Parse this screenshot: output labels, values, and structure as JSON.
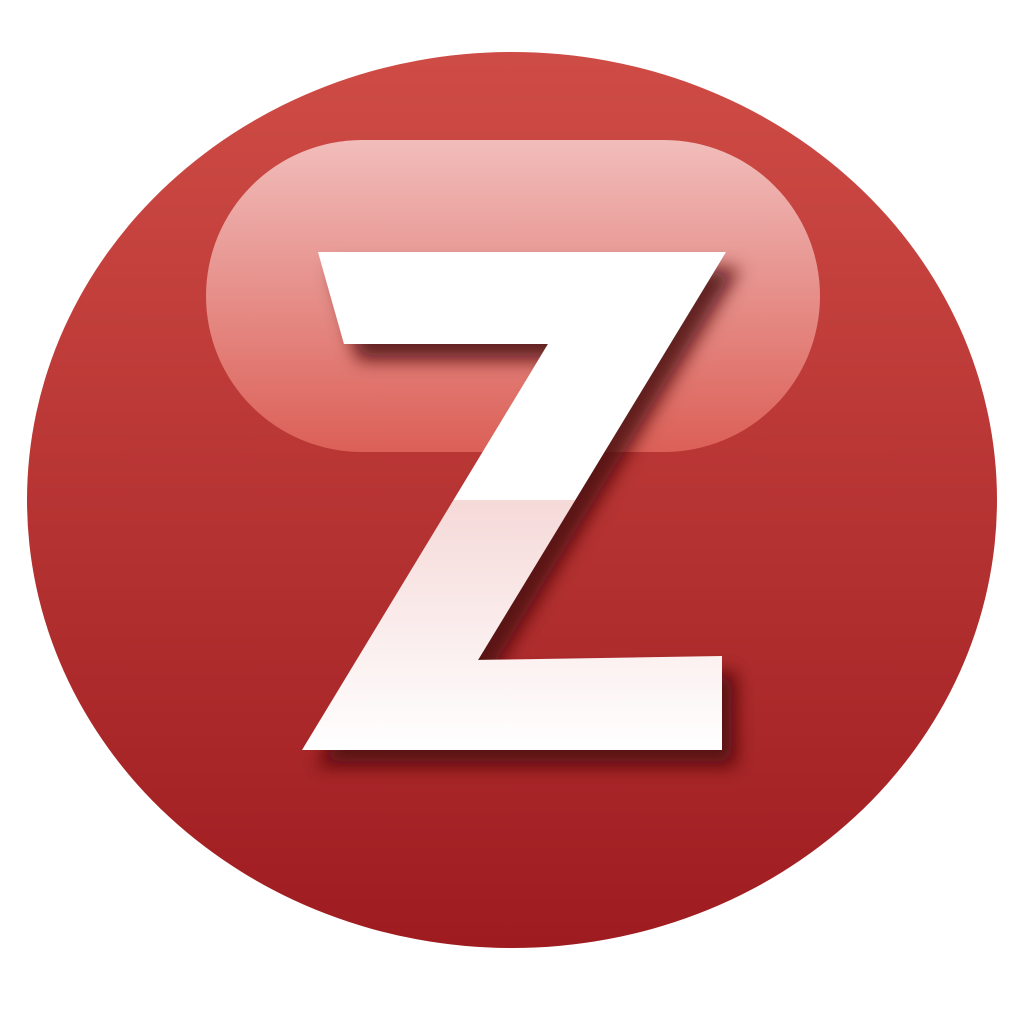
{
  "logo": {
    "letter": "Z",
    "icon": "z-letter-app-icon",
    "colors": {
      "circle_top": "#cf4c46",
      "circle_bottom": "#9e1c20",
      "gloss_top": "#f3c3c1",
      "gloss_bottom": "#dd6259",
      "letter": "#ffffff",
      "letter_lower_tint": "#ecb4b2",
      "shadow": "#4a0b0d",
      "background": "#ffffff"
    }
  }
}
